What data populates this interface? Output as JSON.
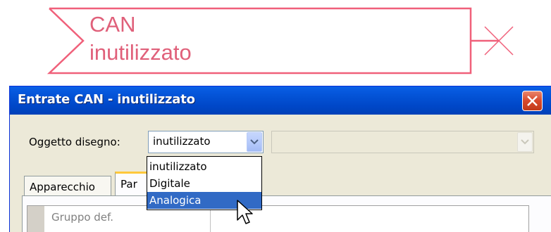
{
  "diagram": {
    "can_line1": "CAN",
    "can_line2": "inutilizzato",
    "colors": {
      "outline": "#f0607a",
      "text": "#e0607a"
    }
  },
  "dialog": {
    "title": "Entrate CAN - inutilizzato",
    "close_icon": "close-x-icon",
    "object_label": "Oggetto disegno:",
    "object_value": "inutilizzato",
    "secondary_combo_value": "",
    "tabs": [
      {
        "label": "Apparecchio"
      },
      {
        "label": "Par"
      }
    ],
    "grid": {
      "first_cell": "Gruppo def."
    },
    "dropdown_options": [
      {
        "label": "inutilizzato"
      },
      {
        "label": "Digitale"
      },
      {
        "label": "Analogica"
      }
    ],
    "selected_option": "Analogica",
    "colors": {
      "titlebar": "#0454d8",
      "window_bg": "#ece9d8",
      "selection": "#316ac5",
      "close": "#d8482b",
      "active_tab_accent": "#ffc83c"
    }
  },
  "cursor_icon": "arrow-pointer-icon"
}
